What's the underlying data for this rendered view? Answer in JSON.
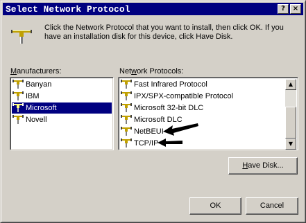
{
  "window": {
    "title": "Select Network Protocol",
    "help_button": "?",
    "close_button": "×"
  },
  "instructions": "Click the Network Protocol that you want to install, then click OK. If you have an installation disk for this device, click Have Disk.",
  "manufacturers": {
    "label": "Manufacturers:",
    "items": [
      "Banyan",
      "IBM",
      "Microsoft",
      "Novell"
    ],
    "selected": "Microsoft"
  },
  "protocols": {
    "label": "Network Protocols:",
    "items": [
      "Fast Infrared Protocol",
      "IPX/SPX-compatible Protocol",
      "Microsoft 32-bit DLC",
      "Microsoft DLC",
      "NetBEUI",
      "TCP/IP"
    ],
    "annotated_items": [
      "NetBEUI",
      "TCP/IP"
    ]
  },
  "buttons": {
    "have_disk": "Have Disk...",
    "have_disk_mnemonic": "H",
    "have_disk_rest": "ave Disk...",
    "ok": "OK",
    "cancel": "Cancel"
  },
  "colors": {
    "face": "#d4d0c8",
    "title_bar": "#000080",
    "selection": "#000080"
  },
  "icons": {
    "dialog": "network-cable-icon",
    "list_item": "network-protocol-icon"
  }
}
